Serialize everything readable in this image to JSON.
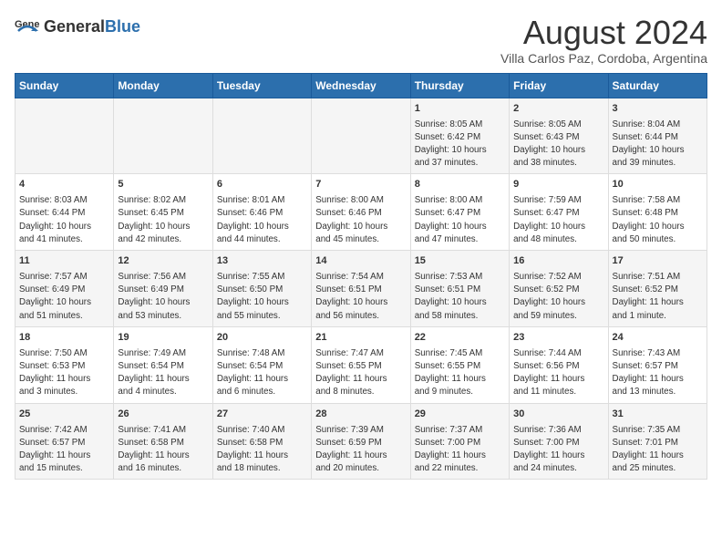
{
  "header": {
    "logo_general": "General",
    "logo_blue": "Blue",
    "month_year": "August 2024",
    "location": "Villa Carlos Paz, Cordoba, Argentina"
  },
  "days_of_week": [
    "Sunday",
    "Monday",
    "Tuesday",
    "Wednesday",
    "Thursday",
    "Friday",
    "Saturday"
  ],
  "weeks": [
    [
      {
        "day": "",
        "content": ""
      },
      {
        "day": "",
        "content": ""
      },
      {
        "day": "",
        "content": ""
      },
      {
        "day": "",
        "content": ""
      },
      {
        "day": "1",
        "content": "Sunrise: 8:05 AM\nSunset: 6:42 PM\nDaylight: 10 hours\nand 37 minutes."
      },
      {
        "day": "2",
        "content": "Sunrise: 8:05 AM\nSunset: 6:43 PM\nDaylight: 10 hours\nand 38 minutes."
      },
      {
        "day": "3",
        "content": "Sunrise: 8:04 AM\nSunset: 6:44 PM\nDaylight: 10 hours\nand 39 minutes."
      }
    ],
    [
      {
        "day": "4",
        "content": "Sunrise: 8:03 AM\nSunset: 6:44 PM\nDaylight: 10 hours\nand 41 minutes."
      },
      {
        "day": "5",
        "content": "Sunrise: 8:02 AM\nSunset: 6:45 PM\nDaylight: 10 hours\nand 42 minutes."
      },
      {
        "day": "6",
        "content": "Sunrise: 8:01 AM\nSunset: 6:46 PM\nDaylight: 10 hours\nand 44 minutes."
      },
      {
        "day": "7",
        "content": "Sunrise: 8:00 AM\nSunset: 6:46 PM\nDaylight: 10 hours\nand 45 minutes."
      },
      {
        "day": "8",
        "content": "Sunrise: 8:00 AM\nSunset: 6:47 PM\nDaylight: 10 hours\nand 47 minutes."
      },
      {
        "day": "9",
        "content": "Sunrise: 7:59 AM\nSunset: 6:47 PM\nDaylight: 10 hours\nand 48 minutes."
      },
      {
        "day": "10",
        "content": "Sunrise: 7:58 AM\nSunset: 6:48 PM\nDaylight: 10 hours\nand 50 minutes."
      }
    ],
    [
      {
        "day": "11",
        "content": "Sunrise: 7:57 AM\nSunset: 6:49 PM\nDaylight: 10 hours\nand 51 minutes."
      },
      {
        "day": "12",
        "content": "Sunrise: 7:56 AM\nSunset: 6:49 PM\nDaylight: 10 hours\nand 53 minutes."
      },
      {
        "day": "13",
        "content": "Sunrise: 7:55 AM\nSunset: 6:50 PM\nDaylight: 10 hours\nand 55 minutes."
      },
      {
        "day": "14",
        "content": "Sunrise: 7:54 AM\nSunset: 6:51 PM\nDaylight: 10 hours\nand 56 minutes."
      },
      {
        "day": "15",
        "content": "Sunrise: 7:53 AM\nSunset: 6:51 PM\nDaylight: 10 hours\nand 58 minutes."
      },
      {
        "day": "16",
        "content": "Sunrise: 7:52 AM\nSunset: 6:52 PM\nDaylight: 10 hours\nand 59 minutes."
      },
      {
        "day": "17",
        "content": "Sunrise: 7:51 AM\nSunset: 6:52 PM\nDaylight: 11 hours\nand 1 minute."
      }
    ],
    [
      {
        "day": "18",
        "content": "Sunrise: 7:50 AM\nSunset: 6:53 PM\nDaylight: 11 hours\nand 3 minutes."
      },
      {
        "day": "19",
        "content": "Sunrise: 7:49 AM\nSunset: 6:54 PM\nDaylight: 11 hours\nand 4 minutes."
      },
      {
        "day": "20",
        "content": "Sunrise: 7:48 AM\nSunset: 6:54 PM\nDaylight: 11 hours\nand 6 minutes."
      },
      {
        "day": "21",
        "content": "Sunrise: 7:47 AM\nSunset: 6:55 PM\nDaylight: 11 hours\nand 8 minutes."
      },
      {
        "day": "22",
        "content": "Sunrise: 7:45 AM\nSunset: 6:55 PM\nDaylight: 11 hours\nand 9 minutes."
      },
      {
        "day": "23",
        "content": "Sunrise: 7:44 AM\nSunset: 6:56 PM\nDaylight: 11 hours\nand 11 minutes."
      },
      {
        "day": "24",
        "content": "Sunrise: 7:43 AM\nSunset: 6:57 PM\nDaylight: 11 hours\nand 13 minutes."
      }
    ],
    [
      {
        "day": "25",
        "content": "Sunrise: 7:42 AM\nSunset: 6:57 PM\nDaylight: 11 hours\nand 15 minutes."
      },
      {
        "day": "26",
        "content": "Sunrise: 7:41 AM\nSunset: 6:58 PM\nDaylight: 11 hours\nand 16 minutes."
      },
      {
        "day": "27",
        "content": "Sunrise: 7:40 AM\nSunset: 6:58 PM\nDaylight: 11 hours\nand 18 minutes."
      },
      {
        "day": "28",
        "content": "Sunrise: 7:39 AM\nSunset: 6:59 PM\nDaylight: 11 hours\nand 20 minutes."
      },
      {
        "day": "29",
        "content": "Sunrise: 7:37 AM\nSunset: 7:00 PM\nDaylight: 11 hours\nand 22 minutes."
      },
      {
        "day": "30",
        "content": "Sunrise: 7:36 AM\nSunset: 7:00 PM\nDaylight: 11 hours\nand 24 minutes."
      },
      {
        "day": "31",
        "content": "Sunrise: 7:35 AM\nSunset: 7:01 PM\nDaylight: 11 hours\nand 25 minutes."
      }
    ]
  ]
}
